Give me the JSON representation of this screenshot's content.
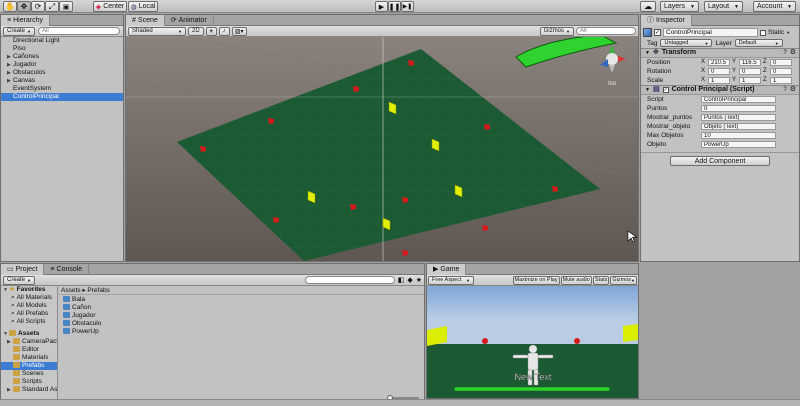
{
  "toolbar": {
    "pivot": "Center",
    "space": "Local",
    "layers": "Layers",
    "layout": "Layout",
    "account": "Account"
  },
  "hierarchy": {
    "tab": "Hierarchy",
    "create": "Create",
    "search_placeholder": "All",
    "items": [
      {
        "label": "Directional Light",
        "fold": "",
        "selected": false
      },
      {
        "label": "Piso",
        "fold": "",
        "selected": false
      },
      {
        "label": "Cañones",
        "fold": "▶",
        "selected": false
      },
      {
        "label": "Jugador",
        "fold": "▶",
        "selected": false
      },
      {
        "label": "Obstaculos",
        "fold": "▶",
        "selected": false
      },
      {
        "label": "Canvas",
        "fold": "▶",
        "selected": false
      },
      {
        "label": "EventSystem",
        "fold": "",
        "selected": false
      },
      {
        "label": "ControlPrincipal",
        "fold": "",
        "selected": true
      }
    ]
  },
  "scene": {
    "tab_scene": "Scene",
    "tab_animator": "Animator",
    "shading": "Shaded",
    "mode_2d": "2D",
    "gizmos": "Gizmos",
    "search_placeholder": "All",
    "persp": "Iso"
  },
  "inspector": {
    "tab": "Inspector",
    "object_name": "ControlPrincipal",
    "static_label": "Static",
    "tag_label": "Tag",
    "tag_value": "Untagged",
    "layer_label": "Layer",
    "layer_value": "Default",
    "transform": {
      "title": "Transform",
      "rows": [
        {
          "label": "Position",
          "x": "210.5",
          "y": "116.5",
          "z": "0"
        },
        {
          "label": "Rotation",
          "x": "0",
          "y": "0",
          "z": "0"
        },
        {
          "label": "Scale",
          "x": "1",
          "y": "1",
          "z": "1"
        }
      ]
    },
    "script_component": {
      "title": "Control Principal (Script)",
      "rows": [
        {
          "label": "Script",
          "value": "ControlPrincipal"
        },
        {
          "label": "Puntos",
          "value": "0"
        },
        {
          "label": "Mostrar_puntos",
          "value": "Puntos (Text)"
        },
        {
          "label": "Mostrar_objeto",
          "value": "Objeto (Text)"
        },
        {
          "label": "Max Objetos",
          "value": "10"
        },
        {
          "label": "Objeto",
          "value": "PowerUp"
        }
      ]
    },
    "add_component": "Add Component"
  },
  "project": {
    "tab_project": "Project",
    "tab_console": "Console",
    "create": "Create",
    "favorites_title": "Favorites",
    "favorites": [
      "All Materials",
      "All Models",
      "All Prefabs",
      "All Scripts"
    ],
    "assets_title": "Assets",
    "asset_folders": [
      "CameraPack",
      "Editor",
      "Materials",
      "Prefabs",
      "Scenes",
      "Scripts",
      "Standard As"
    ],
    "breadcrumb_root": "Assets",
    "breadcrumb_sep": "▸",
    "breadcrumb_current": "Prefabs",
    "prefabs": [
      "Bala",
      "Cañon",
      "Jugador",
      "Obstaculo",
      "PowerUp"
    ]
  },
  "game": {
    "tab": "Game",
    "aspect": "Free Aspect",
    "maximize": "Maximize on Play",
    "mute": "Mute audio",
    "stats": "Stats",
    "gizmos": "Gizmos",
    "overlay_text": "New Text"
  },
  "colors": {
    "floor": "#1c5a33",
    "accent_green": "#2fd32f",
    "selection": "#3d7cd3",
    "cannon_red": "#d41a1a",
    "obstacle_yellow": "#e0f000"
  }
}
